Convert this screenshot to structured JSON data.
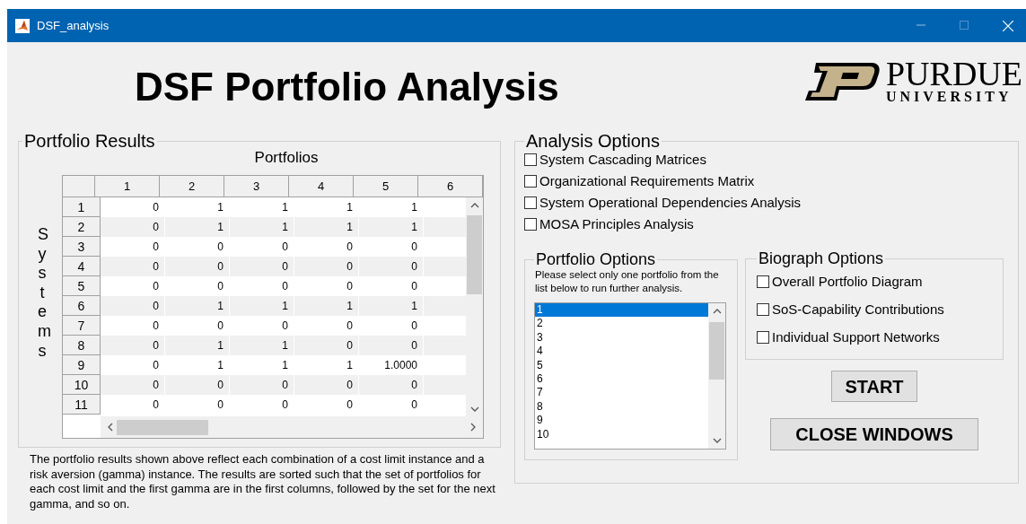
{
  "window": {
    "title": "DSF_analysis"
  },
  "heading": "DSF Portfolio Analysis",
  "logo": {
    "name": "PURDUE",
    "subtitle": "UNIVERSITY"
  },
  "portfolio_results": {
    "title": "Portfolio Results",
    "column_title": "Portfolios",
    "row_title": "Systems",
    "table": {
      "columns": [
        "1",
        "2",
        "3",
        "4",
        "5",
        "6"
      ],
      "rows": [
        {
          "header": "1",
          "cells": [
            "0",
            "1",
            "1",
            "1",
            "1"
          ]
        },
        {
          "header": "2",
          "cells": [
            "0",
            "1",
            "1",
            "1",
            "1"
          ]
        },
        {
          "header": "3",
          "cells": [
            "0",
            "0",
            "0",
            "0",
            "0"
          ]
        },
        {
          "header": "4",
          "cells": [
            "0",
            "0",
            "0",
            "0",
            "0"
          ]
        },
        {
          "header": "5",
          "cells": [
            "0",
            "0",
            "0",
            "0",
            "0"
          ]
        },
        {
          "header": "6",
          "cells": [
            "0",
            "1",
            "1",
            "1",
            "1"
          ]
        },
        {
          "header": "7",
          "cells": [
            "0",
            "0",
            "0",
            "0",
            "0"
          ]
        },
        {
          "header": "8",
          "cells": [
            "0",
            "1",
            "1",
            "0",
            "0"
          ]
        },
        {
          "header": "9",
          "cells": [
            "0",
            "1",
            "1",
            "1",
            "1.0000"
          ]
        },
        {
          "header": "10",
          "cells": [
            "0",
            "0",
            "0",
            "0",
            "0"
          ]
        },
        {
          "header": "11",
          "cells": [
            "0",
            "0",
            "0",
            "0",
            "0"
          ]
        }
      ]
    },
    "description": "The portfolio results shown above reflect each combination of a cost limit instance and a risk aversion (gamma) instance. The results are sorted such that the set of portfolios for each cost limit and the first gamma are in the first columns, followed by the set for the next gamma, and so on."
  },
  "analysis_options": {
    "title": "Analysis Options",
    "checkboxes": [
      {
        "label": "System Cascading Matrices",
        "checked": false
      },
      {
        "label": "Organizational Requirements Matrix",
        "checked": false
      },
      {
        "label": "System Operational Dependencies Analysis",
        "checked": false
      },
      {
        "label": "MOSA Principles Analysis",
        "checked": false
      }
    ],
    "portfolio_options": {
      "title": "Portfolio Options",
      "hint": "Please select only one portfolio from the list below to run further analysis.",
      "list": [
        {
          "label": "1",
          "selected": true
        },
        {
          "label": "2",
          "selected": false
        },
        {
          "label": "3",
          "selected": false
        },
        {
          "label": "4",
          "selected": false
        },
        {
          "label": "5",
          "selected": false
        },
        {
          "label": "6",
          "selected": false
        },
        {
          "label": "7",
          "selected": false
        },
        {
          "label": "8",
          "selected": false
        },
        {
          "label": "9",
          "selected": false
        },
        {
          "label": "10",
          "selected": false
        }
      ]
    },
    "biograph_options": {
      "title": "Biograph Options",
      "checkboxes": [
        {
          "label": "Overall Portfolio Diagram",
          "checked": false
        },
        {
          "label": "SoS-Capability Contributions",
          "checked": false
        },
        {
          "label": "Individual Support Networks",
          "checked": false
        }
      ]
    },
    "buttons": [
      "START",
      "CLOSE WINDOWS"
    ]
  }
}
